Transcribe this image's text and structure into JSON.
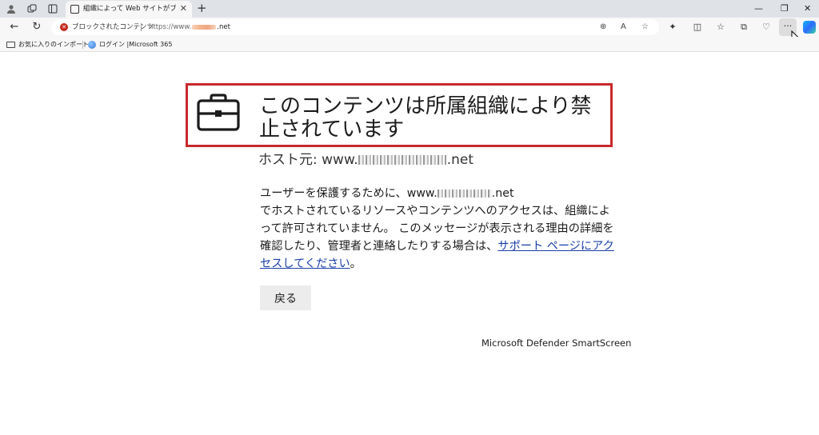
{
  "tab": {
    "title": "組織によって Web サイトがブロックされ"
  },
  "toolbar": {
    "blocked_label": "ブロックされたコンテンツ",
    "url_prefix": "https://www.",
    "url_suffix": ".net"
  },
  "favorites": {
    "items": [
      {
        "label": "お気に入りのインポート",
        "icon": "folder-icon"
      },
      {
        "label": "ログイン |Microsoft 365",
        "icon": "microsoft-365-icon"
      }
    ]
  },
  "page": {
    "heading": "このコンテンツは所属組織により禁止されています",
    "host_prefix": "ホスト元: www.",
    "host_suffix": ".net",
    "body_line1_prefix": "ユーザーを保護するために、www.",
    "body_line1_suffix": ".net",
    "body_text": "でホストされているリソースやコンテンツへのアクセスは、組織によって許可されていません。 このメッセージが表示される理由の詳細を確認したり、管理者と連絡したりする場合は、",
    "support_link": "サポート ページにアクセスしてください",
    "body_end": "。",
    "back_button": "戻る",
    "footer": "Microsoft Defender SmartScreen"
  },
  "colors": {
    "highlight_border": "#c8282d",
    "link": "#1a3ea8",
    "blocked_badge": "#c42b1c"
  }
}
